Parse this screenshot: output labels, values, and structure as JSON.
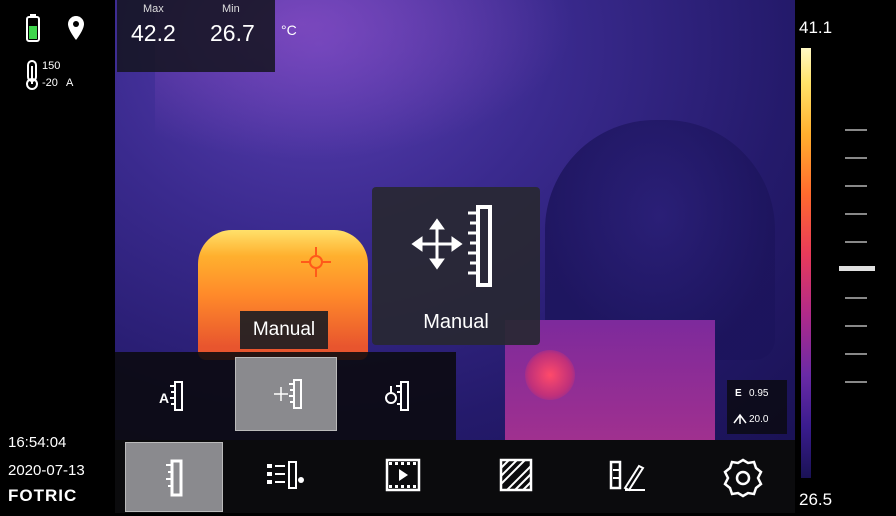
{
  "status": {
    "battery_icon": "battery-icon",
    "location_icon": "location-pin-icon",
    "range_icon": "thermometer-icon",
    "range_high": "150",
    "range_low": "-20",
    "range_mode": "A"
  },
  "readout": {
    "max_label": "Max",
    "max_value": "42.2",
    "min_label": "Min",
    "min_value": "26.7",
    "unit": "°C"
  },
  "scale": {
    "top_value": "41.1",
    "bottom_value": "26.5"
  },
  "overlay": {
    "popup_label": "Manual",
    "tooltip_label": "Manual"
  },
  "submenu": {
    "items": [
      "auto-scale-icon",
      "manual-scale-icon",
      "touch-scale-icon"
    ]
  },
  "params": {
    "emissivity_label": "E",
    "emissivity_value": "0.95",
    "distance_value": "20.0"
  },
  "footer": {
    "time": "16:54:04",
    "date": "2020-07-13",
    "brand": "FOTRIC"
  },
  "toolbar": {
    "items": [
      "scale-icon",
      "palette-adjust-icon",
      "video-icon",
      "image-mode-icon",
      "edit-icon",
      "settings-icon"
    ]
  },
  "colors": {
    "accent_warm": "#ff9a2e",
    "hot": "#ff3a5a",
    "cool": "#2a1c77"
  }
}
